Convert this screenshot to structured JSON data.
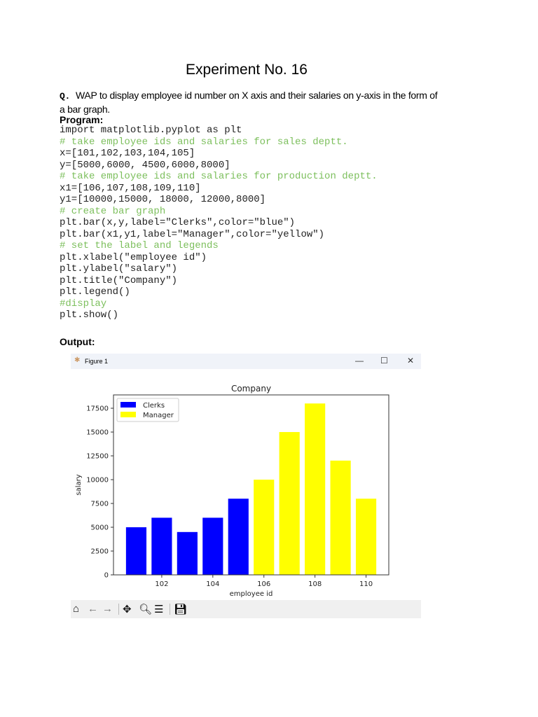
{
  "doc": {
    "title": "Experiment No. 16",
    "question_marker": "Q.",
    "question": "WAP to display employee id number on X axis and their salaries on y-axis in the form of a bar graph.",
    "program_label": "Program:",
    "code_lines": [
      {
        "text": "import matplotlib.pyplot as plt",
        "comment": false
      },
      {
        "text": "# take employee ids and salaries for sales deptt.",
        "comment": true
      },
      {
        "text": "x=[101,102,103,104,105]",
        "comment": false
      },
      {
        "text": "y=[5000,6000, 4500,6000,8000]",
        "comment": false
      },
      {
        "text": "# take employee ids and salaries for production deptt.",
        "comment": true
      },
      {
        "text": "x1=[106,107,108,109,110]",
        "comment": false
      },
      {
        "text": "y1=[10000,15000, 18000, 12000,8000]",
        "comment": false
      },
      {
        "text": "# create bar graph",
        "comment": true
      },
      {
        "text": "plt.bar(x,y,label=\"Clerks\",color=\"blue\")",
        "comment": false
      },
      {
        "text": "plt.bar(x1,y1,label=\"Manager\",color=\"yellow\")",
        "comment": false
      },
      {
        "text": "# set the label and legends",
        "comment": true
      },
      {
        "text": "plt.xlabel(\"employee id\")",
        "comment": false
      },
      {
        "text": "plt.ylabel(\"salary\")",
        "comment": false
      },
      {
        "text": "plt.title(\"Company\")",
        "comment": false
      },
      {
        "text": "plt.legend()",
        "comment": false
      },
      {
        "text": "#display",
        "comment": true
      },
      {
        "text": "plt.show()",
        "comment": false
      }
    ],
    "output_label": "Output:"
  },
  "window": {
    "title": "Figure 1",
    "minimize": "—",
    "maximize": "☐",
    "close": "✕",
    "toolbar": [
      "home-icon",
      "back-icon",
      "forward-icon",
      "pan-icon",
      "zoom-icon",
      "configure-icon",
      "save-icon"
    ]
  },
  "chart_data": {
    "type": "bar",
    "title": "Company",
    "xlabel": "employee id",
    "ylabel": "salary",
    "xlim": [
      100.11,
      110.89
    ],
    "ylim": [
      0,
      18900
    ],
    "xticks": [
      102,
      104,
      106,
      108,
      110
    ],
    "yticks": [
      0,
      2500,
      5000,
      7500,
      10000,
      12500,
      15000,
      17500
    ],
    "legend_position": "upper-left",
    "series": [
      {
        "name": "Clerks",
        "color": "#0000ff",
        "x": [
          101,
          102,
          103,
          104,
          105
        ],
        "values": [
          5000,
          6000,
          4500,
          6000,
          8000
        ]
      },
      {
        "name": "Manager",
        "color": "#ffff00",
        "x": [
          106,
          107,
          108,
          109,
          110
        ],
        "values": [
          10000,
          15000,
          18000,
          12000,
          8000
        ]
      }
    ]
  }
}
